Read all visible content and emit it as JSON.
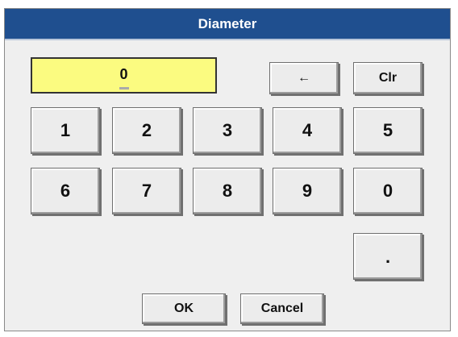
{
  "dialog": {
    "title": "Diameter",
    "display_value": "0"
  },
  "keys": {
    "backspace": "←",
    "clear": "Clr",
    "row1": [
      "1",
      "2",
      "3",
      "4",
      "5"
    ],
    "row2": [
      "6",
      "7",
      "8",
      "9",
      "0"
    ],
    "decimal": ".",
    "ok": "OK",
    "cancel": "Cancel"
  },
  "colors": {
    "titlebar": "#1f4f8f",
    "display_bg": "#fbfb80",
    "dialog_bg": "#efefef"
  }
}
